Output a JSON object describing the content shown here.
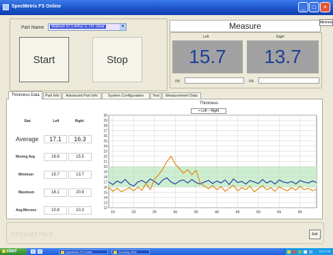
{
  "window": {
    "title": "SpecMetrix FS Online",
    "min": "_",
    "max": "□",
    "close": "×"
  },
  "part": {
    "label": "Part Name",
    "value": "Watson 971-6452 C UV clear"
  },
  "buttons": {
    "start": "Start",
    "stop": "Stop",
    "exit": "Exit",
    "misc": "Minimize"
  },
  "measure": {
    "title": "Measure",
    "left_label": "Left",
    "right_label": "Right",
    "left_value": "15.7",
    "right_value": "13.7",
    "left_pct": "0%",
    "right_pct": "0%",
    "left_progress": 0,
    "right_progress": 0
  },
  "tabs": [
    "Thickness Data",
    "Part Info",
    "Advanced Part Info",
    "System Configuration",
    "Test",
    "Measurement Data"
  ],
  "stats": {
    "header": {
      "stat": "Stat",
      "left": "Left",
      "right": "Right"
    },
    "rows": [
      {
        "label": "Average",
        "left": "17.1",
        "right": "16.3"
      },
      {
        "label": "Moving Avg",
        "left": "16.8",
        "right": "15.5"
      },
      {
        "label": "Minimum",
        "left": "15.7",
        "right": "13.7"
      },
      {
        "label": "Maximum",
        "left": "18.1",
        "right": "20.9"
      },
      {
        "label": "Avg-Microns",
        "left": "10.8",
        "right": "10.3"
      }
    ]
  },
  "chart_data": {
    "type": "line",
    "title": "Thickness",
    "x_ticks": [
      15,
      20,
      25,
      30,
      35,
      40,
      45,
      50,
      55,
      60
    ],
    "y_ticks": [
      12,
      13,
      14,
      15,
      16,
      17,
      18,
      19,
      20,
      21,
      22,
      23,
      24,
      25,
      26,
      27,
      28,
      29,
      30
    ],
    "xlim": [
      14,
      64
    ],
    "ylim": [
      12,
      30
    ],
    "grid": true,
    "legend": "top",
    "band": {
      "from": 16,
      "to": 20,
      "color": "#ccefcf"
    },
    "series": [
      {
        "name": "Left",
        "color": "#2a4aa6",
        "x": [
          14,
          15,
          16,
          17,
          18,
          19,
          20,
          21,
          22,
          23,
          24,
          25,
          26,
          27,
          28,
          29,
          30,
          31,
          32,
          33,
          34,
          35,
          36,
          37,
          38,
          39,
          40,
          41,
          42,
          43,
          44,
          45,
          46,
          47,
          48,
          49,
          50,
          51,
          52,
          53,
          54,
          55,
          56,
          57,
          58,
          59,
          60,
          61,
          62,
          63,
          64
        ],
        "y": [
          17,
          16.5,
          17.2,
          16.8,
          17.5,
          16.6,
          16.2,
          17,
          17.3,
          16.8,
          17.6,
          17.1,
          16.5,
          17.4,
          17.8,
          17,
          16.6,
          17.2,
          17.4,
          16.8,
          17.5,
          16.9,
          16.6,
          17,
          17.3,
          16.7,
          17.2,
          16.8,
          17.4,
          16.5,
          17.6,
          16.9,
          17.1,
          16.6,
          17.3,
          17,
          16.7,
          17.5,
          16.8,
          17.2,
          16.6,
          17.4,
          17,
          16.8,
          17.1,
          16.6,
          17.3,
          17,
          16.8,
          17.2,
          16.9
        ]
      },
      {
        "name": "Right",
        "color": "#e08b1a",
        "x": [
          14,
          15,
          16,
          17,
          18,
          19,
          20,
          21,
          22,
          23,
          24,
          25,
          26,
          27,
          28,
          29,
          30,
          31,
          32,
          33,
          34,
          35,
          36,
          37,
          38,
          39,
          40,
          41,
          42,
          43,
          44,
          45,
          46,
          47,
          48,
          49,
          50,
          51,
          52,
          53,
          54,
          55,
          56,
          57,
          58,
          59,
          60,
          61,
          62,
          63,
          64
        ],
        "y": [
          16,
          15.2,
          15.8,
          15.1,
          15.5,
          15.9,
          15.3,
          16,
          15.4,
          16.8,
          15.5,
          17.6,
          18.4,
          19.5,
          21,
          22,
          20.5,
          19.6,
          18.7,
          19.4,
          18.4,
          19.3,
          16.8,
          16.2,
          15.7,
          16.3,
          15.5,
          16.1,
          15.2,
          15.8,
          16.4,
          15.3,
          15.9,
          15.5,
          16.2,
          15.1,
          15.7,
          16.3,
          15.5,
          15.9,
          15.2,
          16.1,
          15.6,
          15.3,
          15.9,
          15.4,
          16.2,
          15.5,
          15.8,
          15.3,
          15.6
        ]
      }
    ]
  },
  "footer": {
    "logo": "SPECMETRIX"
  },
  "taskbar": {
    "start": "start",
    "task1": "SpecMetrix FS Online",
    "task2": "Thursday 2026",
    "clock": "12:41 PM"
  }
}
